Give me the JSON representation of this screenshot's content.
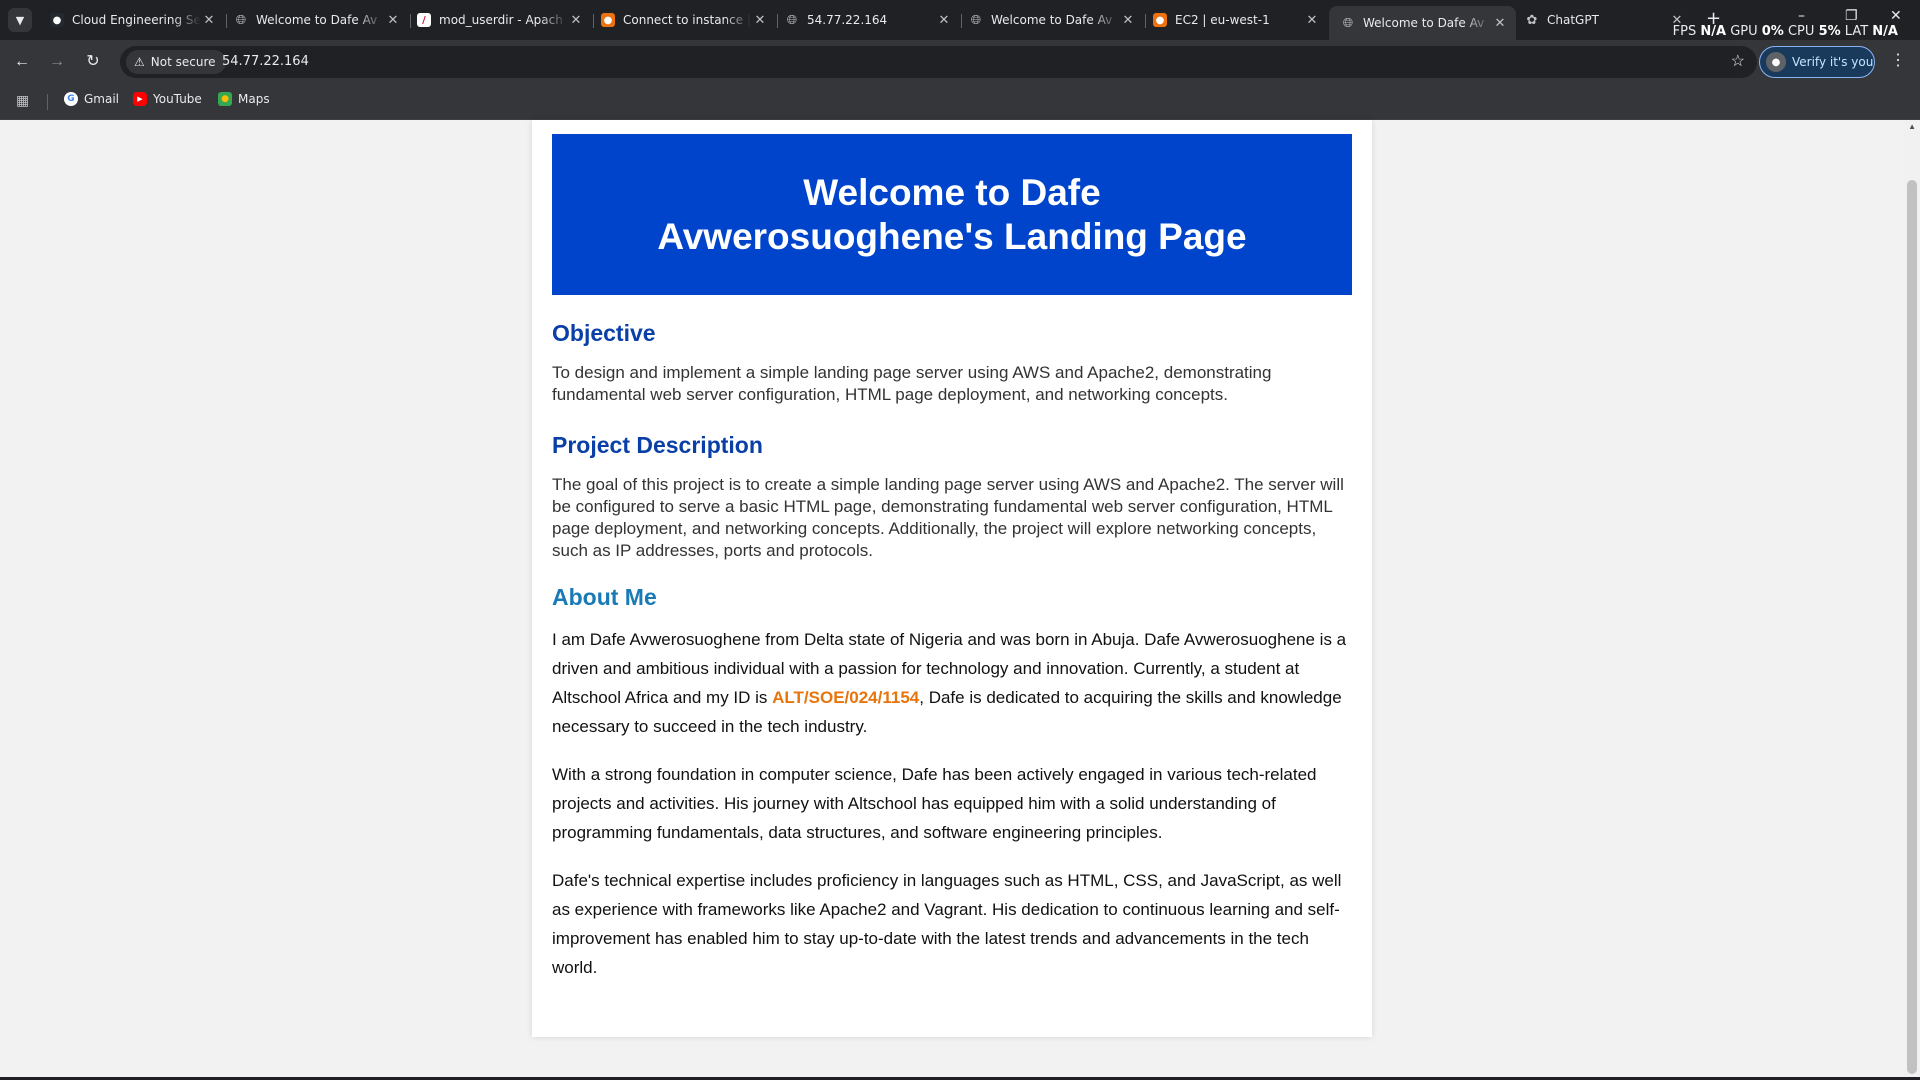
{
  "browser": {
    "tabs": [
      {
        "title": "Cloud Engineering Se",
        "icon": "github-icon",
        "active": false
      },
      {
        "title": "Welcome to Dafe Av",
        "icon": "globe-icon",
        "active": false
      },
      {
        "title": "mod_userdir - Apach",
        "icon": "apache-icon",
        "active": false
      },
      {
        "title": "Connect to instance |",
        "icon": "aws-icon",
        "active": false
      },
      {
        "title": "54.77.22.164",
        "icon": "globe-icon",
        "active": false
      },
      {
        "title": "Welcome to Dafe Av",
        "icon": "globe-icon",
        "active": false
      },
      {
        "title": "EC2 | eu-west-1",
        "icon": "aws-icon",
        "active": false
      },
      {
        "title": "Welcome to Dafe Av",
        "icon": "globe-icon",
        "active": true
      },
      {
        "title": "ChatGPT",
        "icon": "chatgpt-icon",
        "active": false
      }
    ],
    "perf_overlay": {
      "fps_label": "FPS",
      "fps_value": "N/A",
      "gpu_label": "GPU",
      "gpu_value": "0%",
      "cpu_label": "CPU",
      "cpu_value": "5%",
      "lat_label": "LAT",
      "lat_value": "N/A"
    },
    "security_label": "Not secure",
    "url": "54.77.22.164",
    "profile_label": "Verify it's you",
    "bookmarks": [
      {
        "label": "Gmail",
        "icon": "gmail-icon"
      },
      {
        "label": "YouTube",
        "icon": "youtube-icon"
      },
      {
        "label": "Maps",
        "icon": "maps-icon"
      }
    ]
  },
  "page": {
    "banner_title": "Welcome to Dafe Avwerosuoghene's Landing Page",
    "objective_heading": "Objective",
    "objective_text": "To design and implement a simple landing page server using AWS and Apache2, demonstrating fundamental web server configuration, HTML page deployment, and networking concepts.",
    "project_heading": "Project Description",
    "project_text": "The goal of this project is to create a simple landing page server using AWS and Apache2. The server will be configured to serve a basic HTML page, demonstrating fundamental web server configuration, HTML page deployment, and networking concepts. Additionally, the project will explore networking concepts, such as IP addresses, ports and protocols.",
    "about_heading": "About Me",
    "about_p1_before": "I am Dafe Avwerosuoghene from Delta state of Nigeria and was born in Abuja. Dafe Avwerosuoghene is a driven and ambitious individual with a passion for technology and innovation. Currently, a student at Altschool Africa and my ID is ",
    "student_id": "ALT/SOE/024/1154",
    "about_p1_after": ", Dafe is dedicated to acquiring the skills and knowledge necessary to succeed in the tech industry.",
    "about_p2": "With a strong foundation in computer science, Dafe has been actively engaged in various tech-related projects and activities. His journey with Altschool has equipped him with a solid understanding of programming fundamentals, data structures, and software engineering principles.",
    "about_p3": "Dafe's technical expertise includes proficiency in languages such as HTML, CSS, and JavaScript, as well as experience with frameworks like Apache2 and Vagrant. His dedication to continuous learning and self-improvement has enabled him to stay up-to-date with the latest trends and advancements in the tech world."
  },
  "colors": {
    "banner_bg": "#0044cc",
    "heading": "#0a3fa8",
    "about_heading": "#1a7ab5",
    "student_id": "#e8740c"
  }
}
